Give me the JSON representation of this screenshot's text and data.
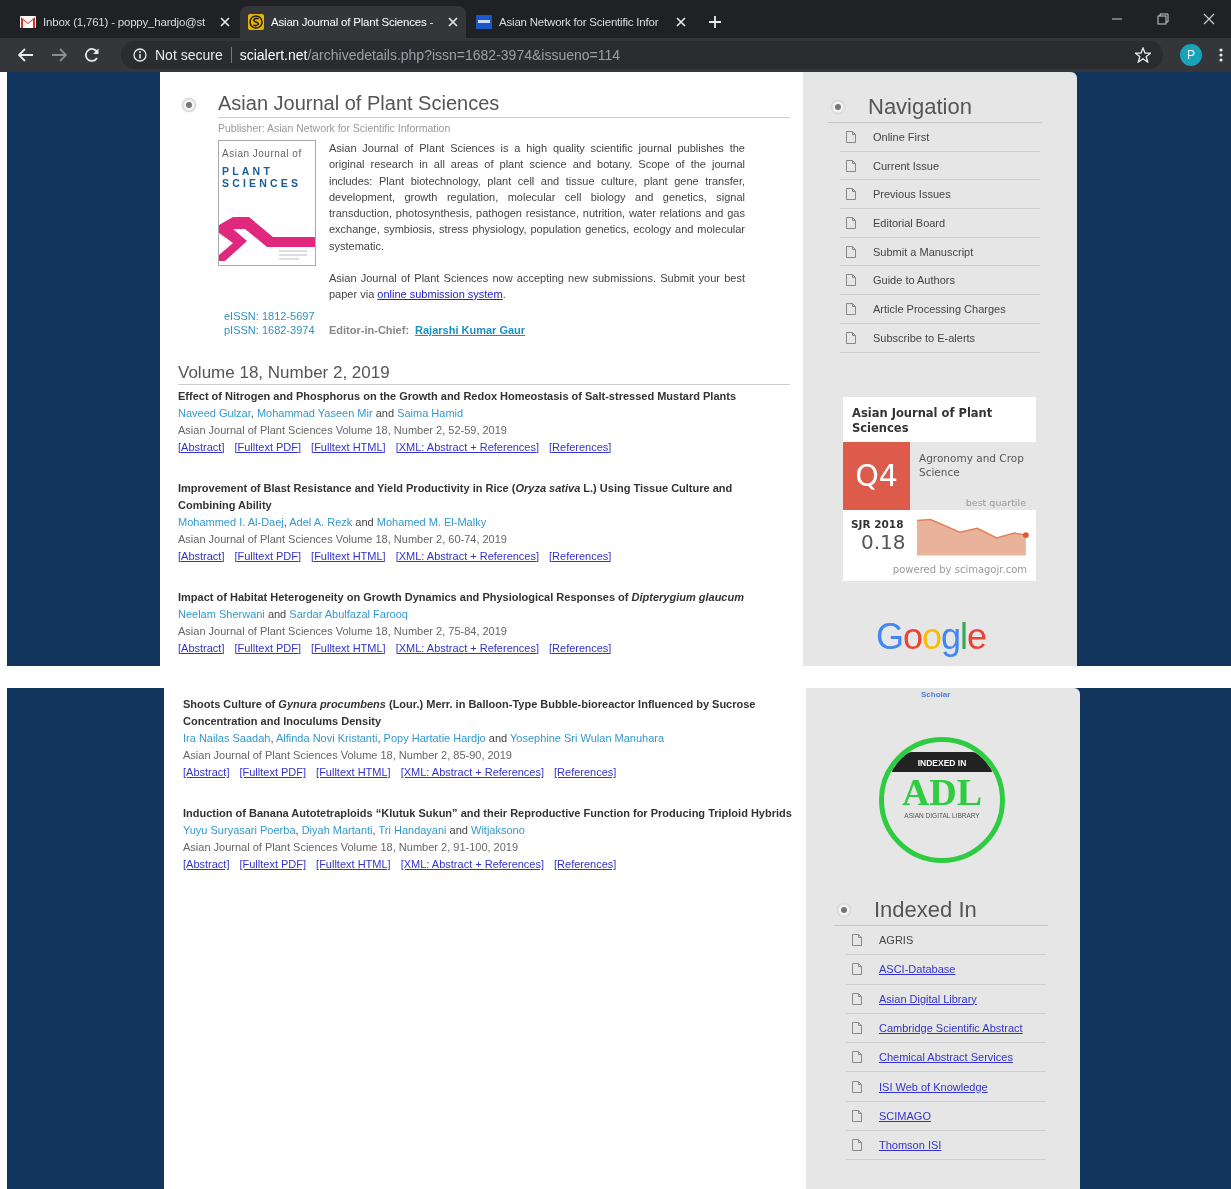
{
  "browser": {
    "tabs": [
      {
        "kind": "mail",
        "title": "Inbox (1,761) - poppy_hardjo@st",
        "selected": false
      },
      {
        "kind": "journal",
        "title": "Asian Journal of Plant Sciences -",
        "selected": true
      },
      {
        "kind": "network",
        "title": "Asian Network for Scientific Infor",
        "selected": false
      }
    ],
    "address_bar": {
      "security_label": "Not secure",
      "domain": "scialert.net",
      "path": "/archivedetails.php?issn=1682-3974&issueno=114",
      "profile_initial": "P"
    }
  },
  "top_capture": {
    "journal": {
      "title": "Asian Journal of Plant Sciences",
      "publisher": "Publisher: Asian Network for Scientific Information",
      "cover": {
        "line1": "Asian Journal of",
        "line2": "PLANT",
        "line3": "SCIENCES"
      },
      "description": "Asian Journal of Plant Sciences is a high quality scientific journal publishes the original research in all areas of plant science and botany. Scope of the journal includes: Plant biotechnology, plant cell and tissue culture, plant gene transfer, development, growth regulation, molecular cell biology and genetics, signal transduction, photosynthesis, pathogen resistance, nutrition, water relations and gas exchange, symbiosis, stress physiology, population genetics, ecology and molecular systematic.",
      "submission": {
        "text": "Asian Journal of Plant Sciences now accepting new submissions. Submit your best paper via ",
        "link": "online submission system",
        "after": "."
      },
      "eissn": "eISSN: 1812-5697",
      "pissn": "pISSN: 1682-3974",
      "editor_label": "Editor-in-Chief:",
      "editor_name": "Rajarshi Kumar Gaur"
    },
    "issue_heading": "Volume 18, Number 2, 2019",
    "articles": [
      {
        "title": "Effect of Nitrogen and Phosphorus on the Growth and Redox Homeostasis of Salt-stressed Mustard Plants",
        "authors": [
          {
            "name": "Naveed Gulzar",
            "sep": ", "
          },
          {
            "name": "Mohammad Yaseen Mir",
            "sep": " and "
          },
          {
            "name": "Saima Hamid"
          }
        ],
        "citation": "Asian Journal of Plant Sciences Volume 18, Number 2, 52-59, 2019",
        "links": [
          "[Abstract]",
          "[Fulltext PDF]",
          "[Fulltext HTML]",
          "[XML: Abstract + References]",
          "[References]"
        ]
      },
      {
        "title": "Improvement of Blast Resistance and Yield Productivity in Rice (*Oryza sativa* L.) Using Tissue Culture and Combining Ability",
        "authors": [
          {
            "name": "Mohammed I. Al-Daej",
            "sep": ", "
          },
          {
            "name": "Adel A. Rezk",
            "sep": " and "
          },
          {
            "name": "Mohamed M. El-Malky"
          }
        ],
        "citation": "Asian Journal of Plant Sciences Volume 18, Number 2, 60-74, 2019",
        "links": [
          "[Abstract]",
          "[Fulltext PDF]",
          "[Fulltext HTML]",
          "[XML: Abstract + References]",
          "[References]"
        ]
      },
      {
        "title": "Impact of Habitat Heterogeneity on Growth Dynamics and Physiological Responses of *Dipterygium glaucum*",
        "authors": [
          {
            "name": "Neelam Sherwani",
            "sep": " and "
          },
          {
            "name": "Sardar Abulfazal Farooq"
          }
        ],
        "citation": "Asian Journal of Plant Sciences Volume 18, Number 2, 75-84, 2019",
        "links": [
          "[Abstract]",
          "[Fulltext PDF]",
          "[Fulltext HTML]",
          "[XML: Abstract + References]",
          "[References]"
        ]
      }
    ],
    "sidebar": {
      "navigation": {
        "heading": "Navigation",
        "items": [
          "Online First",
          "Current Issue",
          "Previous Issues",
          "Editorial Board",
          "Submit a Manuscript",
          "Guide to Authors",
          "Article Processing Charges",
          "Subscribe to E-alerts"
        ]
      },
      "sjr_widget": {
        "journal": "Asian Journal of Plant Sciences",
        "quartile": "Q4",
        "category": "Agronomy and Crop Science",
        "quartile_note": "best quartile",
        "sjr_label": "SJR 2018",
        "sjr_value": "0.18",
        "credit": "powered by scimagojr.com"
      },
      "scholar_logo": "Google"
    }
  },
  "bottom_capture": {
    "articles": [
      {
        "title": "Shoots Culture of *Gynura procumbens* (Lour.) Merr. in Balloon-Type Bubble-bioreactor Influenced by Sucrose Concentration and Inoculums Density",
        "authors": [
          {
            "name": "Ira Nailas Saadah",
            "sep": ", "
          },
          {
            "name": "Alfinda Novi Kristanti",
            "sep": ", "
          },
          {
            "name": "Popy Hartatie Hardjo",
            "sep": " and "
          },
          {
            "name": "Yosephine Sri Wulan Manuhara"
          }
        ],
        "citation": "Asian Journal of Plant Sciences Volume 18, Number 2, 85-90, 2019",
        "links": [
          "[Abstract]",
          "[Fulltext PDF]",
          "[Fulltext HTML]",
          "[XML: Abstract + References]",
          "[References]"
        ]
      },
      {
        "title": "Induction of Banana Autotetraploids “Klutuk Sukun” and their Reproductive Function for Producing Triploid Hybrids",
        "authors": [
          {
            "name": "Yuyu Suryasari Poerba",
            "sep": ", "
          },
          {
            "name": "Diyah Martanti",
            "sep": ", "
          },
          {
            "name": "Tri Handayani",
            "sep": " and "
          },
          {
            "name": "Witjaksono"
          }
        ],
        "citation": "Asian Journal of Plant Sciences Volume 18, Number 2, 91-100, 2019",
        "links": [
          "[Abstract]",
          "[Fulltext PDF]",
          "[Fulltext HTML]",
          "[XML: Abstract + References]",
          "[References]"
        ]
      }
    ],
    "sidebar": {
      "scholar_caption": "Scholar",
      "adl_badge": {
        "banner": "INDEXED IN",
        "logo": "ADL",
        "caption": "ASIAN DIGITAL LIBRARY"
      },
      "indexed_in": {
        "heading": "Indexed In",
        "items": [
          {
            "label": "AGRIS",
            "kind": "plain"
          },
          {
            "label": "ASCI-Database",
            "kind": "link"
          },
          {
            "label": "Asian Digital Library",
            "kind": "link"
          },
          {
            "label": "Cambridge Scientific Abstract",
            "kind": "link"
          },
          {
            "label": "Chemical Abstract Services",
            "kind": "link"
          },
          {
            "label": "ISI Web of Knowledge",
            "kind": "link"
          },
          {
            "label": "SCIMAGO",
            "kind": "link"
          },
          {
            "label": "Thomson ISI",
            "kind": "link"
          }
        ]
      }
    }
  }
}
